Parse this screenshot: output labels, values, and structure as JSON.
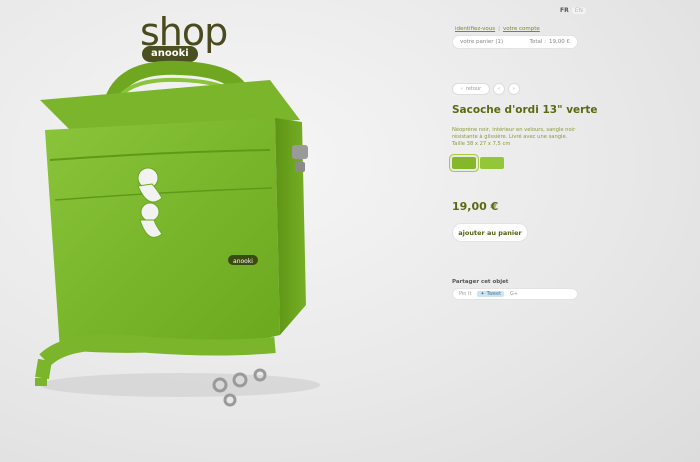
{
  "brand": {
    "shop": "shop",
    "name": "anooki"
  },
  "lang": {
    "selected": "FR",
    "other": "EN"
  },
  "toplinks": {
    "account": "identifiez-vous",
    "separator": "|",
    "contact": "votre compte"
  },
  "cart": {
    "label": "votre panier (1)",
    "total_label": "Total :",
    "total_value": "19,00 €"
  },
  "nav": {
    "back": "retour"
  },
  "product": {
    "title": "Sacoche d'ordi 13\" verte",
    "description": "Néoprène noir, intérieur en velours, sangle noir résistante à glissière. Livré avec une sangle. Taille 38 x 27 x 7,5 cm",
    "price": "19,00 €",
    "add_to_cart": "ajouter au panier",
    "swatch_colors": [
      "#84b82a",
      "#94c63a"
    ],
    "bag_logo": "anooki"
  },
  "share": {
    "label": "Partager cet objet",
    "pin": "Pin it",
    "tweet": "Tweet",
    "gplus": "G+"
  }
}
